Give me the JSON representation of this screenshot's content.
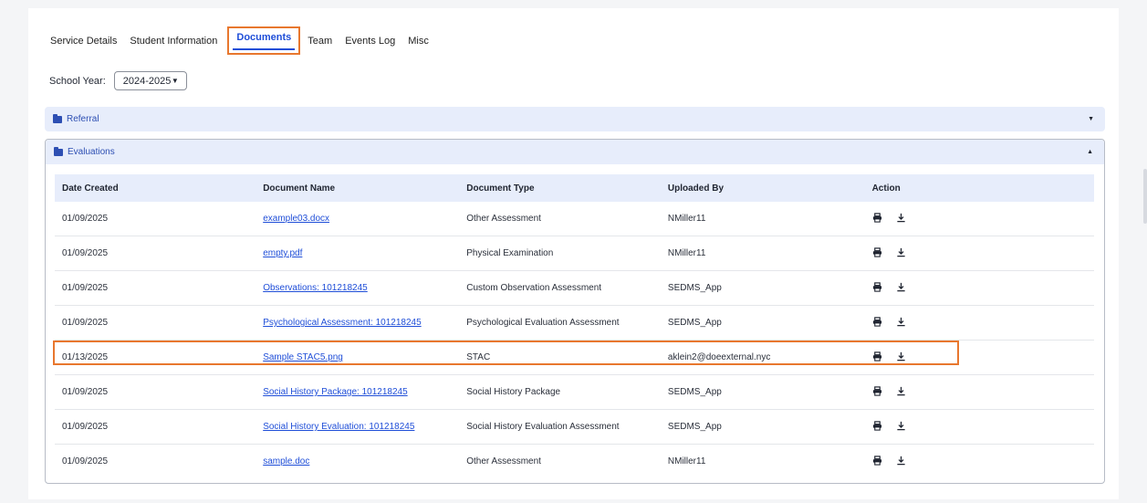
{
  "tabs": [
    {
      "label": "Service Details"
    },
    {
      "label": "Student Information"
    },
    {
      "label": "Documents",
      "active": true
    },
    {
      "label": "Team"
    },
    {
      "label": "Events Log"
    },
    {
      "label": "Misc"
    }
  ],
  "school_year": {
    "label": "School Year:",
    "value": "2024-2025"
  },
  "accordions": {
    "referral": {
      "title": "Referral",
      "expanded": false
    },
    "evaluations": {
      "title": "Evaluations",
      "expanded": true
    }
  },
  "table": {
    "headers": [
      "Date Created",
      "Document Name",
      "Document Type",
      "Uploaded By",
      "Action"
    ],
    "rows": [
      {
        "date": "01/09/2025",
        "name": "example03.docx",
        "type": "Other Assessment",
        "uploaded_by": "NMiller11"
      },
      {
        "date": "01/09/2025",
        "name": "empty.pdf",
        "type": "Physical Examination",
        "uploaded_by": "NMiller11"
      },
      {
        "date": "01/09/2025",
        "name": "Observations: 101218245",
        "type": "Custom Observation Assessment",
        "uploaded_by": "SEDMS_App"
      },
      {
        "date": "01/09/2025",
        "name": "Psychological Assessment: 101218245",
        "type": "Psychological Evaluation Assessment",
        "uploaded_by": "SEDMS_App"
      },
      {
        "date": "01/13/2025",
        "name": "Sample STAC5.png",
        "type": "STAC",
        "uploaded_by": "aklein2@doeexternal.nyc",
        "highlighted": true
      },
      {
        "date": "01/09/2025",
        "name": "Social History Package: 101218245",
        "type": "Social History Package",
        "uploaded_by": "SEDMS_App"
      },
      {
        "date": "01/09/2025",
        "name": "Social History Evaluation: 101218245",
        "type": "Social History Evaluation Assessment",
        "uploaded_by": "SEDMS_App"
      },
      {
        "date": "01/09/2025",
        "name": "sample.doc",
        "type": "Other Assessment",
        "uploaded_by": "NMiller11"
      }
    ],
    "action_icons": [
      "print-icon",
      "download-icon"
    ]
  },
  "colors": {
    "accent": "#1f4ed8",
    "highlight": "#e8772e",
    "header_bg": "#e7edfb"
  }
}
